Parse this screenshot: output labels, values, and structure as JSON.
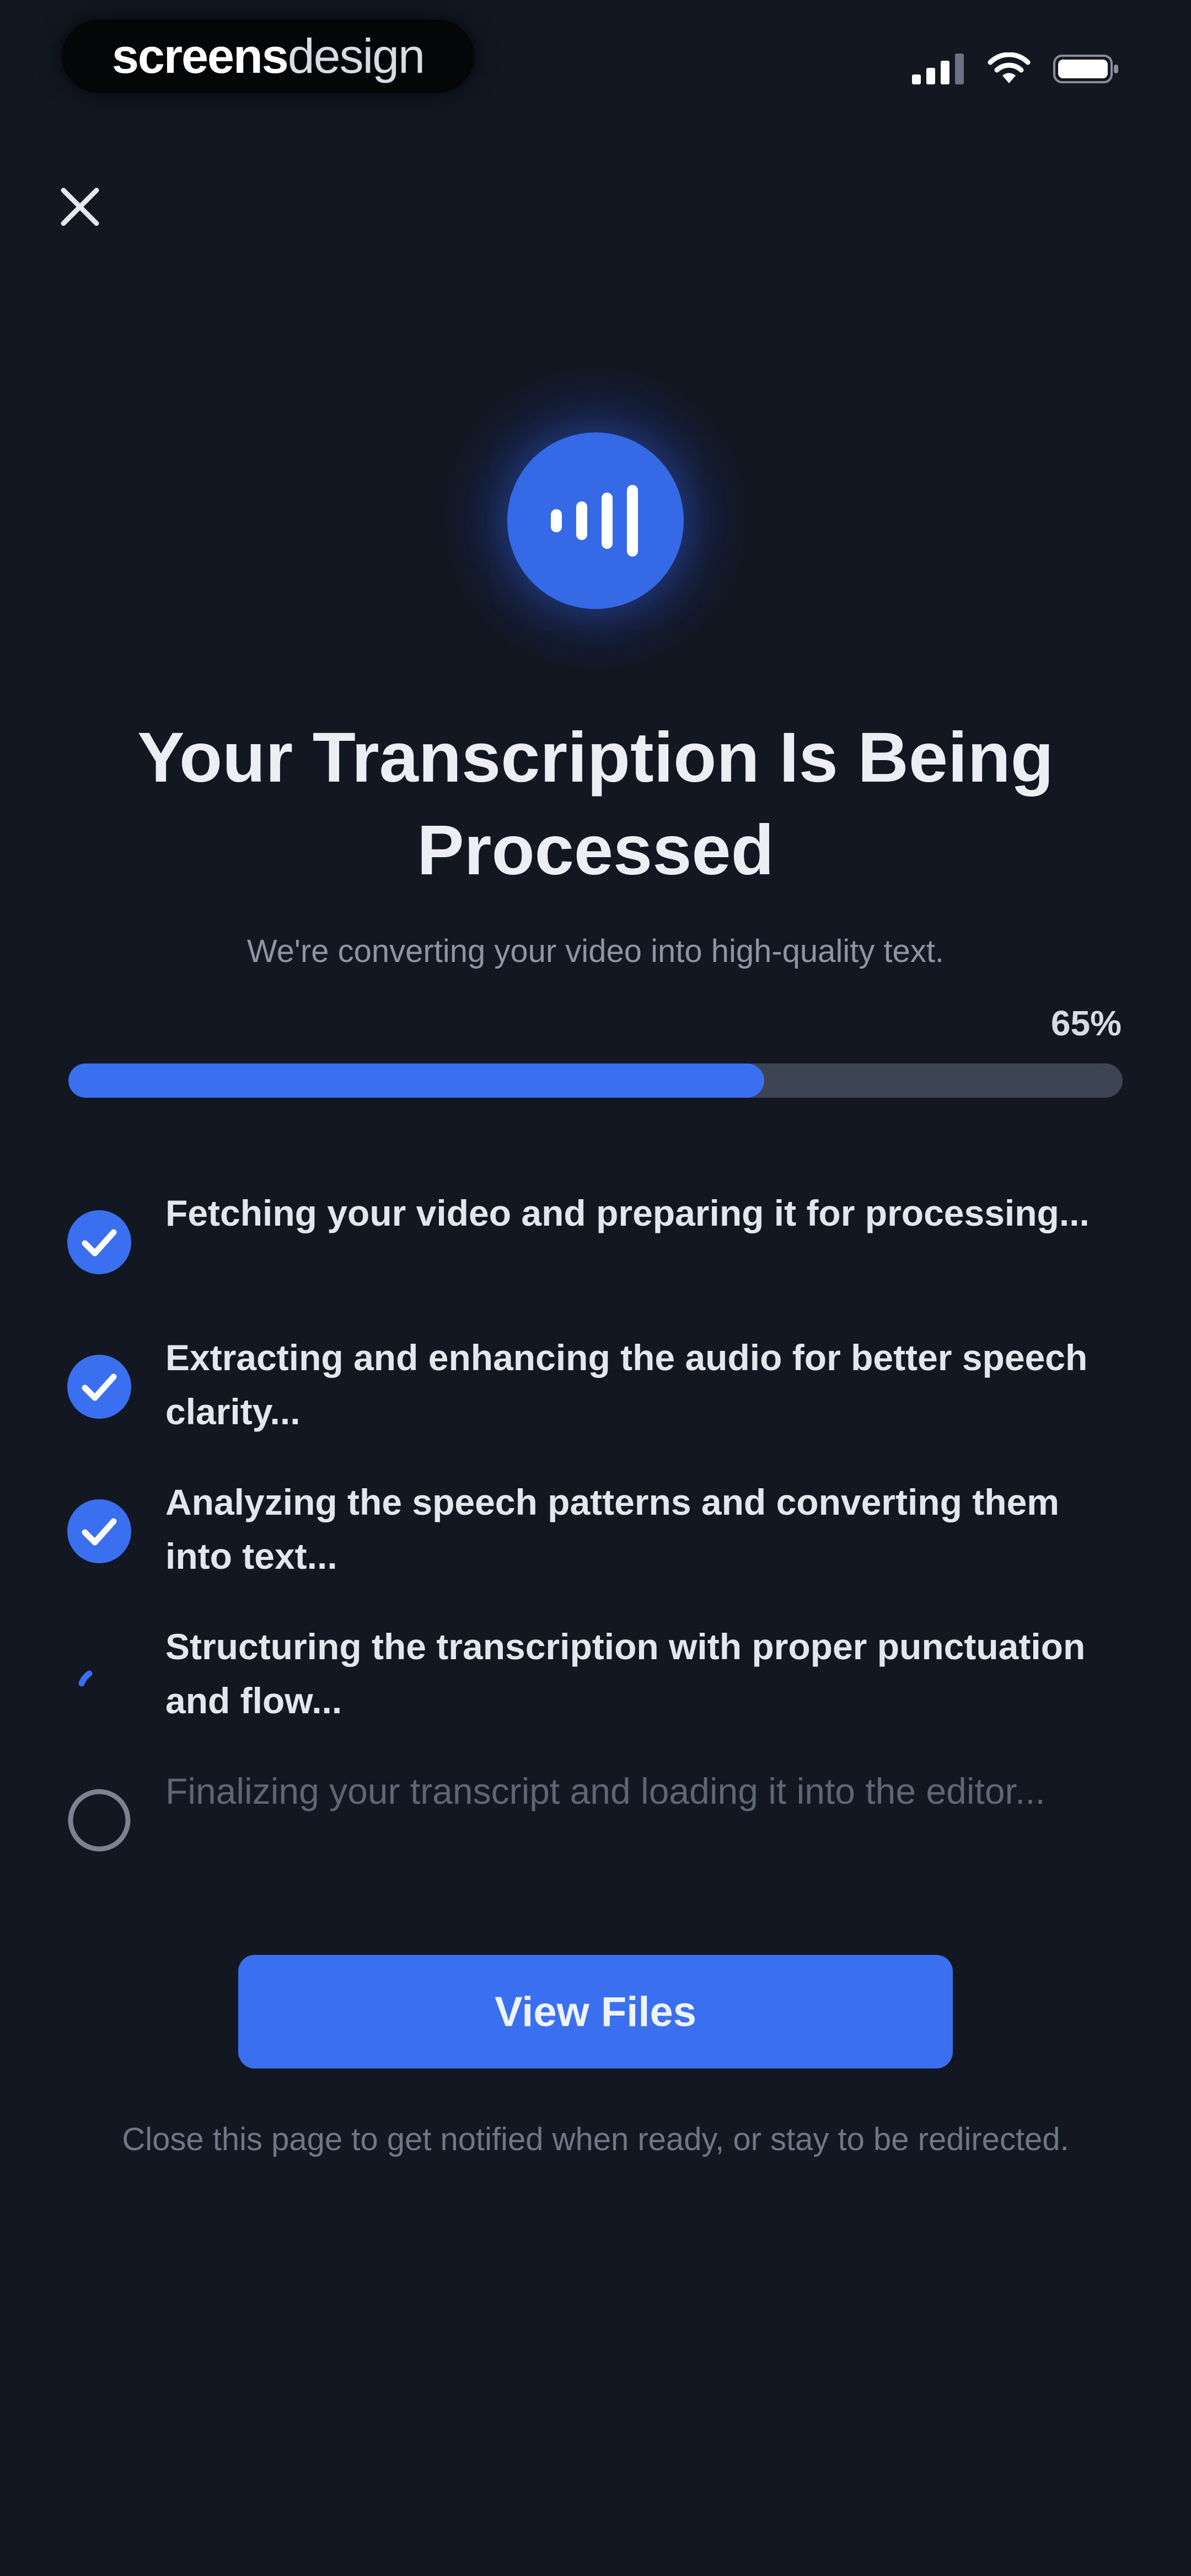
{
  "status_bar": {
    "brand_bold": "screens",
    "brand_light": "design",
    "signal_icon": "cellular-signal-icon",
    "wifi_icon": "wifi-icon",
    "battery_icon": "battery-icon"
  },
  "header": {
    "close_icon": "close-icon"
  },
  "hero": {
    "icon": "audio-waveform-icon",
    "title": "Your Transcription Is Being Processed",
    "subtitle": "We're converting your video into high-quality text."
  },
  "progress": {
    "label": "65%",
    "value": 0.66
  },
  "steps": [
    {
      "label": "Fetching your video and preparing it for processing...",
      "status": "done"
    },
    {
      "label": "Extracting and enhancing the audio for better speech clarity...",
      "status": "done"
    },
    {
      "label": "Analyzing the speech patterns and converting them into text...",
      "status": "done"
    },
    {
      "label": "Structuring the transcription with proper punctuation and flow...",
      "status": "in_progress"
    },
    {
      "label": "Finalizing your transcript and loading it into the editor...",
      "status": "pending"
    }
  ],
  "actions": {
    "view_files_label": "View Files"
  },
  "footnote": "Close this page to get notified when ready, or stay to be redirected.",
  "colors": {
    "background": "#121722",
    "accent": "#3a70ef",
    "track": "#3d4454"
  }
}
